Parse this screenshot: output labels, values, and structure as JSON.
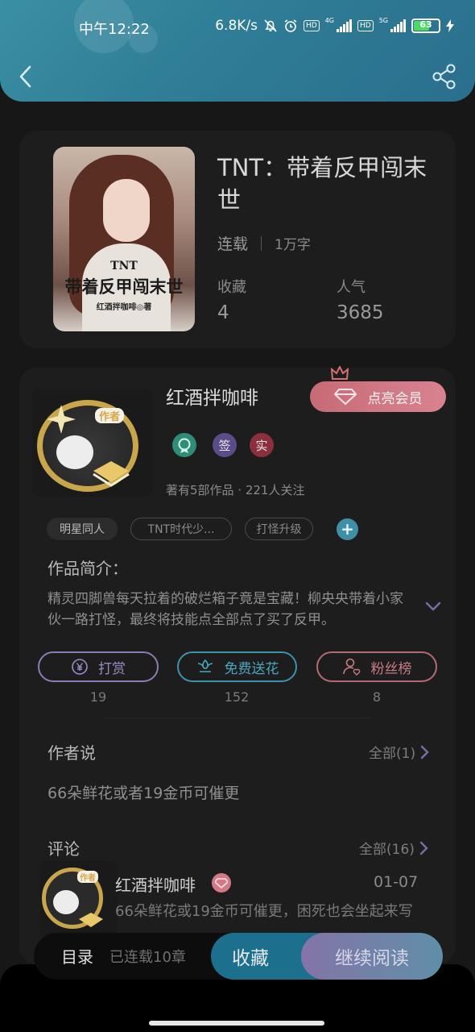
{
  "status_bar": {
    "time": "中午12:22",
    "speed": "6.8K/s",
    "sim1_label": "HD",
    "sim1_net": "4G",
    "sim2_label": "HD",
    "sim2_net": "5G",
    "battery": "63",
    "battery_level": 0.63
  },
  "header": {
    "back_icon": "chevron-left-icon",
    "share_icon": "share-icon"
  },
  "book": {
    "cover_title_small": "TNT",
    "cover_title": "带着反甲闯末世",
    "cover_author": "红酒拌咖啡◎著",
    "title": "TNT：带着反甲闯末世",
    "status": "连载",
    "word_count": "1万字",
    "favorites_label": "收藏",
    "favorites_value": "4",
    "popularity_label": "人气",
    "popularity_value": "3685"
  },
  "author": {
    "avatar_tag": "作者",
    "name": "红酒拌咖啡",
    "vip_button": "点亮会员",
    "badge_signed": "签",
    "badge_real": "实",
    "stats": "著有5部作品 · 221人关注"
  },
  "tags": [
    "明星同人",
    "TNT时代少...",
    "打怪升级"
  ],
  "intro": {
    "heading": "作品简介：",
    "text": "精灵四脚兽每天拉着的破烂箱子竟是宝藏！柳央央带着小家伙一路打怪，最终将技能点全部点了买了反甲。"
  },
  "actions": [
    {
      "label": "打赏",
      "count": "19",
      "icon": "yen-coin-icon",
      "color": "#8d7bb5"
    },
    {
      "label": "免费送花",
      "count": "152",
      "icon": "flower-icon",
      "color": "#3c93ad"
    },
    {
      "label": "粉丝榜",
      "count": "8",
      "icon": "fans-person-icon",
      "color": "#b46a73"
    }
  ],
  "author_says": {
    "heading": "作者说",
    "see_all": "全部(1)",
    "text": "66朵鲜花或者19金币可催更"
  },
  "comments": {
    "heading": "评论",
    "see_all": "全部(16)",
    "items": [
      {
        "avatar_tag": "作者",
        "name": "红酒拌咖啡",
        "date": "01-07",
        "text": "66朵鲜花或19金币可催更，困死也会坐起来写"
      }
    ]
  },
  "bottom_bar": {
    "toc": "目录",
    "status": "已连载10章",
    "favorite": "收藏",
    "continue_reading": "继续阅读"
  },
  "colors": {
    "header": "#2f7d96",
    "vip": "#d98390",
    "accent_teal": "#1c6f8d"
  }
}
